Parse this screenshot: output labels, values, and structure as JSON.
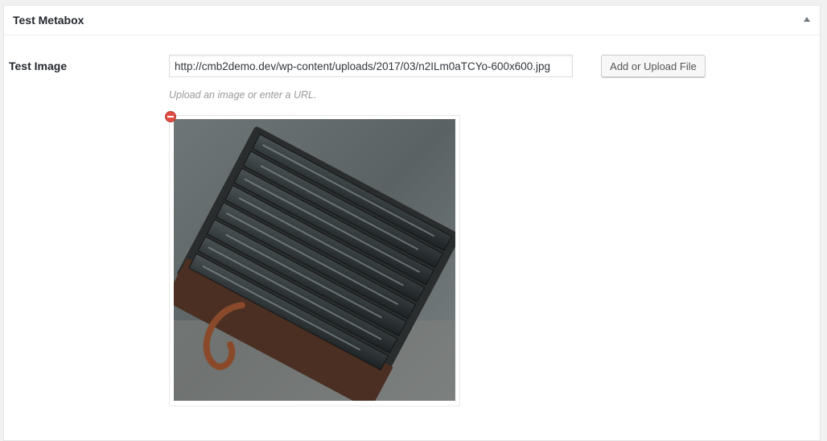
{
  "metabox": {
    "title": "Test Metabox",
    "toggle_icon": "triangle-up-icon"
  },
  "field": {
    "label": "Test Image",
    "url_value": "http://cmb2demo.dev/wp-content/uploads/2017/03/n2ILm0aTCYo-600x600.jpg",
    "button_label": "Add or Upload File",
    "description": "Upload an image or enter a URL.",
    "remove_icon": "remove-circle-icon"
  },
  "colors": {
    "remove_red": "#e14d43",
    "accent_text": "#23282d",
    "muted_text": "#999999"
  }
}
